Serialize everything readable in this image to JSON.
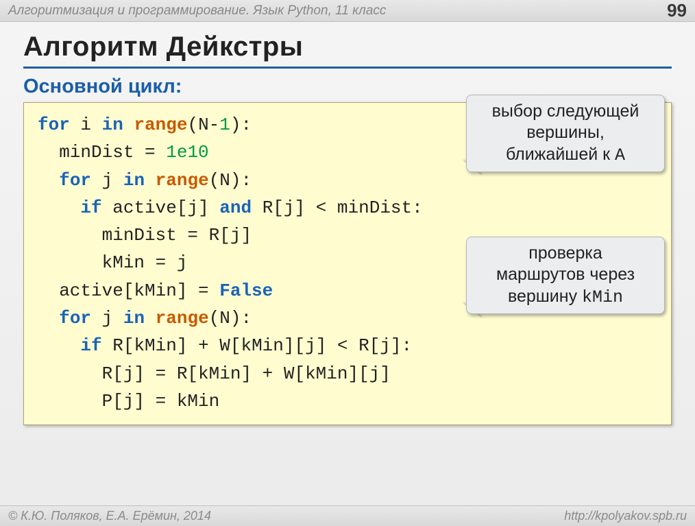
{
  "header": {
    "title": "Алгоритмизация и программирование. Язык Python, 11 класс",
    "page": "99"
  },
  "titles": {
    "main": "Алгоритм Дейкстры",
    "sub": "Основной цикл:"
  },
  "code": {
    "l1a": "for",
    "l1b": " i ",
    "l1c": "in",
    "l1d": " ",
    "l1e": "range",
    "l1f": "(N-",
    "l1g": "1",
    "l1h": "):",
    "l2a": "  minDist = ",
    "l2b": "1e10",
    "l3a": "  ",
    "l3b": "for",
    "l3c": " j ",
    "l3d": "in",
    "l3e": " ",
    "l3f": "range",
    "l3g": "(N):",
    "l4a": "    ",
    "l4b": "if",
    "l4c": " active[j] ",
    "l4d": "and",
    "l4e": " R[j] < minDist:",
    "l5": "      minDist = R[j]",
    "l6": "      kMin = j",
    "l7a": "  active[kMin] = ",
    "l7b": "False",
    "l8a": "  ",
    "l8b": "for",
    "l8c": " j ",
    "l8d": "in",
    "l8e": " ",
    "l8f": "range",
    "l8g": "(N):",
    "l9a": "    ",
    "l9b": "if",
    "l9c": " R[kMin] + W[kMin][j] < R[j]:",
    "l10": "      R[j] = R[kMin] + W[kMin][j]",
    "l11": "      P[j] = kMin"
  },
  "callouts": {
    "c1_line1": "выбор следующей",
    "c1_line2": "вершины,",
    "c1_line3a": "ближайшей к ",
    "c1_line3b": "A",
    "c2_line1": "проверка",
    "c2_line2": "маршрутов через",
    "c2_line3a": "вершину ",
    "c2_line3b": "kMin"
  },
  "footer": {
    "left": "© К.Ю. Поляков, Е.А. Ерёмин, 2014",
    "right": "http://kpolyakov.spb.ru"
  }
}
